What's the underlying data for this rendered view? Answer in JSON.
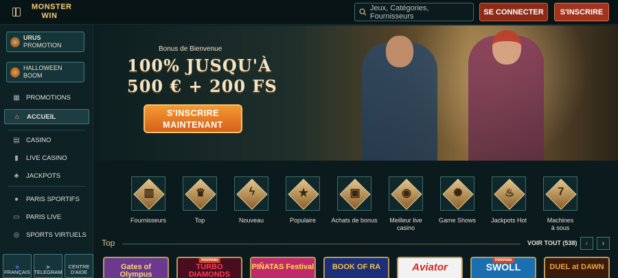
{
  "header": {
    "logo": [
      "MONSTER",
      "WIN"
    ],
    "search_placeholder": "Jeux, Catégories, Fournisseurs",
    "login_label": "SE CONNECTER",
    "signup_label": "S'INSCRIRE"
  },
  "sidebar": {
    "promos": [
      {
        "line1": "URUS",
        "line2": "PROMOTION"
      },
      {
        "line1": "HALLOWEEN",
        "line2": "BOOM"
      }
    ],
    "items": [
      {
        "label": "PROMOTIONS",
        "icon": "gift-icon"
      },
      {
        "label": "ACCUEIL",
        "icon": "home-icon",
        "active": true
      },
      {
        "label": "CASINO",
        "icon": "slot-icon"
      },
      {
        "label": "LIVE CASINO",
        "icon": "card-icon"
      },
      {
        "label": "JACKPOTS",
        "icon": "clover-icon"
      },
      {
        "label": "PARIS SPORTIFS",
        "icon": "ball-icon"
      },
      {
        "label": "PARIS LIVE",
        "icon": "live-icon"
      },
      {
        "label": "SPORTS VIRTUELS",
        "icon": "virtual-icon"
      }
    ],
    "bottom": [
      {
        "label": "FRANÇAIS",
        "icon": "flag-icon"
      },
      {
        "label": "TELEGRAM",
        "icon": "telegram-icon"
      },
      {
        "label": "CENTRE D'AIDE",
        "icon": "help-icon"
      }
    ]
  },
  "hero": {
    "tagline": "Bonus de Bienvenue",
    "title_line1": "100% JUSQU'À",
    "title_line2": "500 € + 200 FS",
    "cta_line1": "S'INSCRIRE",
    "cta_line2": "MAINTENANT"
  },
  "categories": [
    {
      "label": "Fournisseurs",
      "icon": "book-icon"
    },
    {
      "label": "Top",
      "icon": "crown-icon"
    },
    {
      "label": "Nouveau",
      "icon": "lightning-icon"
    },
    {
      "label": "Populaire",
      "icon": "star-icon"
    },
    {
      "label": "Achats de bonus",
      "icon": "chest-icon"
    },
    {
      "label": "Meilleur live casino",
      "icon": "chip-icon"
    },
    {
      "label": "Game Shows",
      "icon": "wheel-icon"
    },
    {
      "label": "Jackpots Hot",
      "icon": "flame-icon"
    },
    {
      "label": "Machines à sous",
      "icon": "slot-machine-icon"
    }
  ],
  "section": {
    "title": "Top",
    "view_all": "VOIR TOUT (538)"
  },
  "games": [
    {
      "title": "Gates of Olympus",
      "badge": "",
      "bg": "#6b3a8e",
      "color": "#ffd56a"
    },
    {
      "title": "TURBO DIAMONDS",
      "badge": "nouveau",
      "bg": "#4a0d1e",
      "color": "#ff3d5a"
    },
    {
      "title": "PIÑATAS Festival",
      "badge": "",
      "bg": "#c02a6a",
      "color": "#ffe14a"
    },
    {
      "title": "BOOK OF RA",
      "badge": "",
      "bg": "#1c2f7a",
      "color": "#f5c542"
    },
    {
      "title": "Aviator",
      "badge": "",
      "bg": "#f2f2f2",
      "color": "#d8241f"
    },
    {
      "title": "SWOLL",
      "badge": "nouveau",
      "bg": "#1a6fb0",
      "color": "#ffffff"
    },
    {
      "title": "DUEL at DAWN",
      "badge": "",
      "bg": "#3b1b0c",
      "color": "#f0a340"
    }
  ]
}
